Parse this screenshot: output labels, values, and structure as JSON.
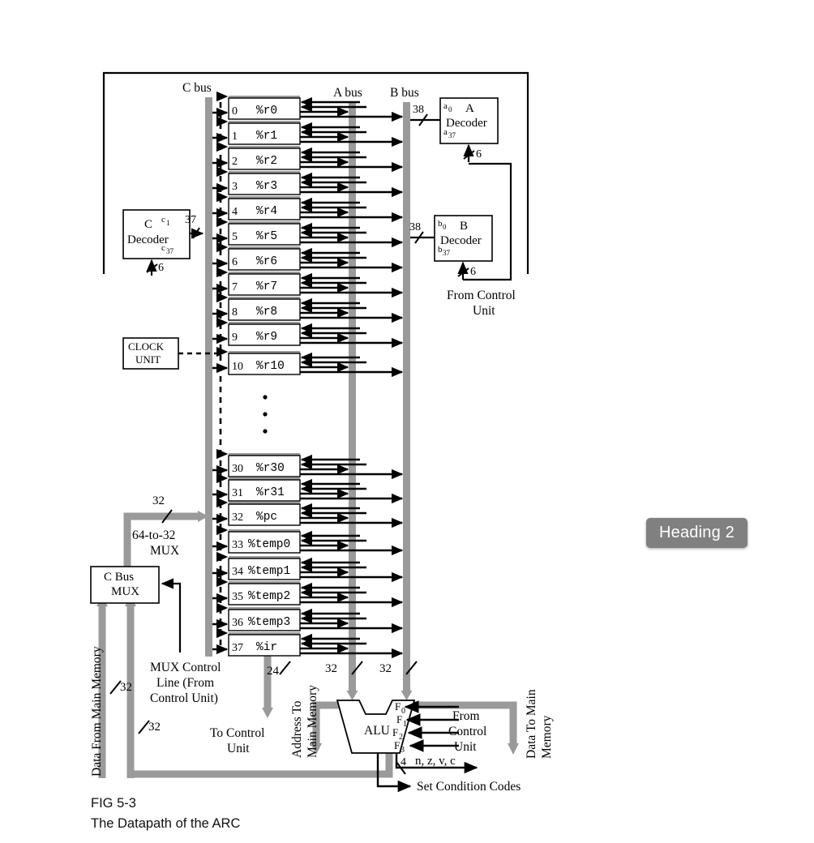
{
  "figure": {
    "caption_id": "FIG 5-3",
    "caption_text": "The Datapath of the ARC"
  },
  "badge": {
    "label": "Heading 2"
  },
  "buses": {
    "c_bus": "C bus",
    "a_bus": "A bus",
    "b_bus": "B bus"
  },
  "decoders": {
    "c": {
      "name_line1": "C",
      "name_line2": "Decoder",
      "top_sub": "c",
      "top_sub_idx": "1",
      "bot_sub": "c",
      "bot_sub_idx": "37",
      "out_width": "37",
      "in_width": "6"
    },
    "a": {
      "name_line1": "A",
      "name_line2": "Decoder",
      "top_sub": "a",
      "top_sub_idx": "0",
      "bot_sub": "a",
      "bot_sub_idx": "37",
      "in_width": "38",
      "ctrl_width": "6"
    },
    "b": {
      "name_line1": "B",
      "name_line2": "Decoder",
      "top_sub": "b",
      "top_sub_idx": "0",
      "bot_sub": "b",
      "bot_sub_idx": "37",
      "in_width": "38",
      "ctrl_width": "6"
    }
  },
  "clock_unit": {
    "line1": "CLOCK",
    "line2": "UNIT"
  },
  "labels": {
    "from_control_unit_1": "From Control",
    "from_control_unit_2": "Unit",
    "mux_64to32_l1": "64-to-32",
    "mux_64to32_l2": "MUX",
    "c_bus_mux_l1": "C Bus",
    "c_bus_mux_l2": "MUX",
    "mux_ctrl_l1": "MUX Control",
    "mux_ctrl_l2": "Line (From",
    "mux_ctrl_l3": "Control Unit)",
    "to_control_unit_l1": "To Control",
    "to_control_unit_l2": "Unit",
    "data_from_main_memory": "Data From Main Memory",
    "address_to_main_memory_l1": "Address To",
    "address_to_main_memory_l2": "Main Memory",
    "data_to_main_memory_l1": "Data To Main",
    "data_to_main_memory_l2": "Memory",
    "alu": "ALU",
    "alu_from_control_l1": "From",
    "alu_from_control_l2": "Control",
    "alu_from_control_l3": "Unit",
    "condition_flags": "n, z, v, c",
    "set_condition_codes": "Set Condition Codes"
  },
  "widths": {
    "mux_out": "32",
    "mem_in_left": "32",
    "mem_in_right": "32",
    "to_control": "24",
    "a_bus_alu": "32",
    "b_bus_alu": "32",
    "cond_codes": "4"
  },
  "alu_function_inputs": [
    {
      "label": "F",
      "index": "0"
    },
    {
      "label": "F",
      "index": "1"
    },
    {
      "label": "F",
      "index": "2"
    },
    {
      "label": "F",
      "index": "3"
    }
  ],
  "registers": [
    {
      "num": "0",
      "name": "%r0"
    },
    {
      "num": "1",
      "name": "%r1"
    },
    {
      "num": "2",
      "name": "%r2"
    },
    {
      "num": "3",
      "name": "%r3"
    },
    {
      "num": "4",
      "name": "%r4"
    },
    {
      "num": "5",
      "name": "%r5"
    },
    {
      "num": "6",
      "name": "%r6"
    },
    {
      "num": "7",
      "name": "%r7"
    },
    {
      "num": "8",
      "name": "%r8"
    },
    {
      "num": "9",
      "name": "%r9"
    },
    {
      "num": "10",
      "name": "%r10"
    },
    {
      "num": "30",
      "name": "%r30"
    },
    {
      "num": "31",
      "name": "%r31"
    },
    {
      "num": "32",
      "name": "%pc"
    },
    {
      "num": "33",
      "name": "%temp0"
    },
    {
      "num": "34",
      "name": "%temp1"
    },
    {
      "num": "35",
      "name": "%temp2"
    },
    {
      "num": "36",
      "name": "%temp3"
    },
    {
      "num": "37",
      "name": "%ir"
    }
  ],
  "ellipsis": "•",
  "colors": {
    "bus_gray": "#9a9a9a",
    "line_black": "#000000",
    "badge_bg": "#808080"
  }
}
